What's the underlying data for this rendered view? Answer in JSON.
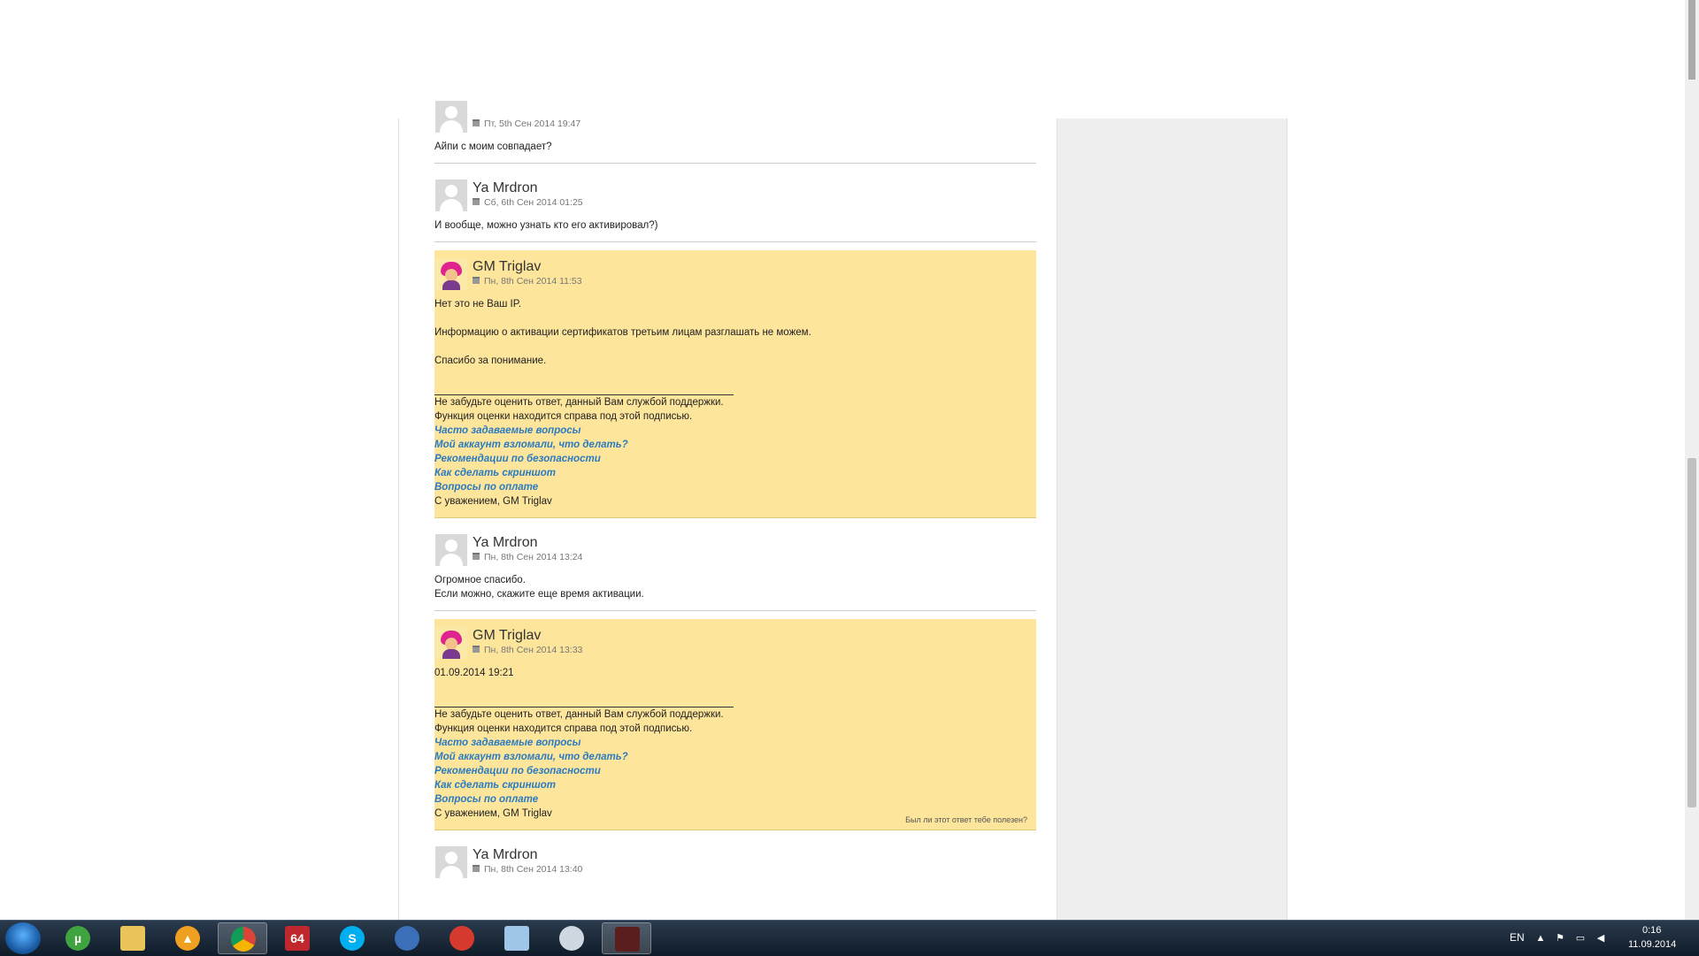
{
  "posts": [
    {
      "author": "",
      "date": "Пт, 5th Сен 2014 19:47",
      "body": [
        "Айпи с моим совпадает?"
      ]
    },
    {
      "author": "Ya Mrdron",
      "date": "Сб, 6th Сен 2014 01:25",
      "body": [
        "И вообще, можно узнать кто его активировал?)"
      ]
    },
    {
      "author": "GM Triglav",
      "date": "Пн, 8th Сен 2014 11:53",
      "body": [
        "Нет это не Ваш IP.",
        "",
        "Информацию о активации сертификатов третьим лицам разглашать не можем.",
        "",
        "Спасибо за понимание."
      ]
    },
    {
      "author": "Ya Mrdron",
      "date": "Пн, 8th Сен 2014 13:24",
      "body": [
        "Огромное спасибо.",
        "Если можно, скажите еще время активации."
      ]
    },
    {
      "author": "GM Triglav",
      "date": "Пн, 8th Сен 2014 13:33",
      "body": [
        "01.09.2014 19:21"
      ],
      "helpful": "Был ли этот ответ тебе полезен?"
    },
    {
      "author": "Ya Mrdron",
      "date": "Пн, 8th Сен 2014 13:40"
    }
  ],
  "signature": {
    "line1": "Не забудьте оценить ответ, данный Вам службой поддержки.",
    "line2": "Функция оценки находится справа под этой подписью.",
    "links": [
      "Часто задаваемые вопросы",
      "Мой аккаунт взломали, что делать?",
      "Рекомендации по безопасности",
      "Как сделать скриншот",
      "Вопросы по оплате"
    ],
    "closing": "С уважением, GM Triglav"
  },
  "taskbar": {
    "apps": [
      "windows-start",
      "utorrent",
      "file-explorer",
      "aimp",
      "chrome",
      "aida64",
      "skype",
      "app-blue",
      "ccleaner",
      "notepad",
      "app-helmet",
      "game"
    ],
    "badge_64": "64",
    "badge_s": "S",
    "language": "EN",
    "time": "0:16",
    "date": "11.09.2014"
  }
}
